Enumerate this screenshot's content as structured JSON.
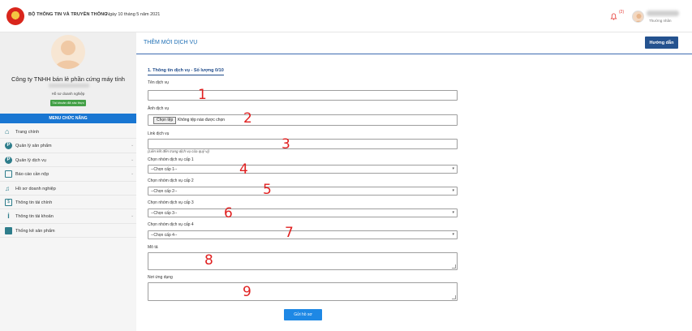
{
  "header": {
    "org_name": "BỘ THÔNG TIN VÀ TRUYỀN THÔNG",
    "date": "Ngày 10 tháng 5 năm 2021",
    "notification_count": "(2)",
    "user_role": "Thường nhân"
  },
  "sidebar": {
    "company_name": "Công ty TNHH bán lẻ phần cứng máy tính",
    "doc_link": "Hồ sơ doanh nghiệp",
    "status_badge": "Tài khoản đã xác thực",
    "menu_header": "MENU CHỨC NĂNG",
    "items": [
      {
        "label": "Trang chính",
        "icon": "home-icon",
        "has_chevron": false
      },
      {
        "label": "Quản lý sản phẩm",
        "icon": "product-icon",
        "has_chevron": true
      },
      {
        "label": "Quản lý dịch vụ",
        "icon": "service-icon",
        "has_chevron": true
      },
      {
        "label": "Báo cáo cần nộp",
        "icon": "report-icon",
        "has_chevron": true
      },
      {
        "label": "Hồ sơ doanh nghiệp",
        "icon": "bell-icon",
        "has_chevron": false
      },
      {
        "label": "Thông tin tài chính",
        "icon": "money-icon",
        "has_chevron": false
      },
      {
        "label": "Thông tin tài khoản",
        "icon": "info-icon",
        "has_chevron": true
      },
      {
        "label": "Thống kê sản phẩm",
        "icon": "book-icon",
        "has_chevron": false
      }
    ]
  },
  "main": {
    "page_title": "THÊM MỚI DỊCH VỤ",
    "help_button": "Hướng dẫn",
    "section_title": "1. Thông tin dịch vụ - Số lượng 0/10",
    "fields": {
      "service_name_label": "Tên dịch vụ",
      "service_image_label": "Ảnh dịch vụ",
      "file_button": "Chọn tệp",
      "file_none": "Không tệp nào được chọn",
      "service_link_label": "Link dịch vụ",
      "service_link_hint": "(Liên kết đến trang dịch vụ của quý vị)",
      "group1_label": "Chọn nhóm dịch vụ cấp 1",
      "group1_value": "--Chọn cấp 1--",
      "group2_label": "Chọn nhóm dịch vụ cấp 2",
      "group2_value": "--Chọn cấp 2--",
      "group3_label": "Chọn nhóm dịch vụ cấp 3",
      "group3_value": "--Chọn cấp 3--",
      "group4_label": "Chọn nhóm dịch vụ cấp 4",
      "group4_value": "--Chọn cấp 4--",
      "description_label": "Mô tả",
      "application_label": "Nơi ứng dụng"
    },
    "submit_button": "Gửi hồ sơ"
  },
  "annotations": [
    "1",
    "2",
    "3",
    "4",
    "5",
    "6",
    "7",
    "8",
    "9"
  ],
  "colors": {
    "menu_header": "#1976d2",
    "help_button": "#24528f",
    "title_text": "#1e6fb5",
    "badge": "#43a047",
    "annotation": "#e02020"
  }
}
